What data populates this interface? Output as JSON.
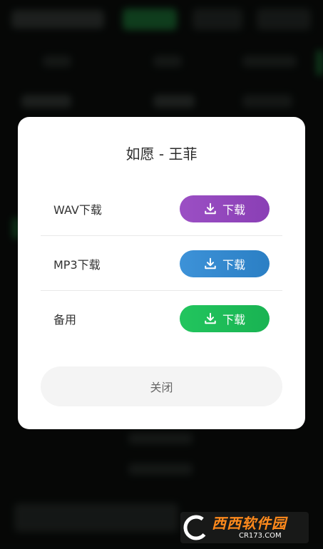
{
  "dialog": {
    "title": "如愿 - 王菲",
    "options": [
      {
        "label": "WAV下载",
        "button": "下载",
        "color": "#9b4fc4",
        "color2": "#8a3fb5"
      },
      {
        "label": "MP3下载",
        "button": "下载",
        "color": "#3d92d8",
        "color2": "#2b7fc4"
      },
      {
        "label": "备用",
        "button": "下载",
        "color": "#22c55e",
        "color2": "#19b352"
      }
    ],
    "close_label": "关闭"
  },
  "watermark": {
    "logo_text": "C",
    "brand": "西西软件园",
    "site": "CR173.COM"
  },
  "colors": {
    "background": "#0b0e0c",
    "dialog_bg": "#ffffff",
    "close_bg": "#f4f4f4"
  }
}
